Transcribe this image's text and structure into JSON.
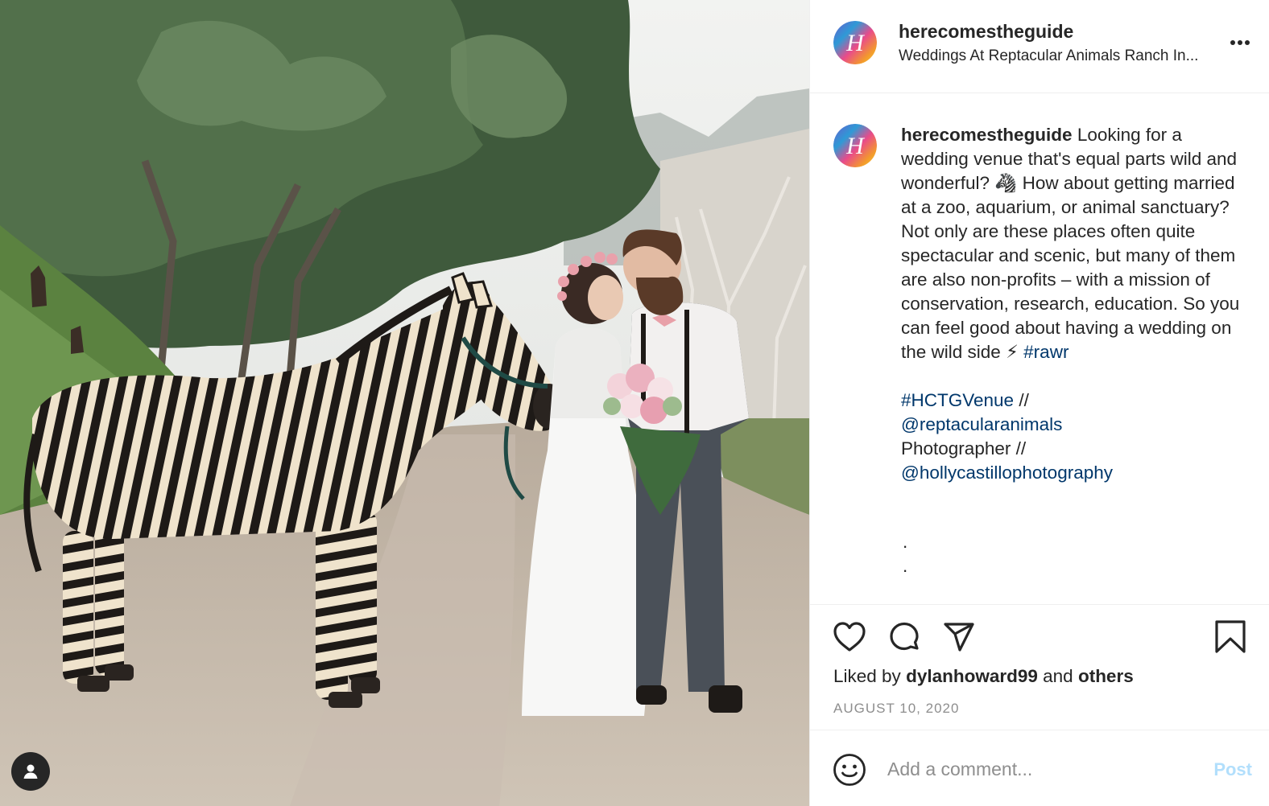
{
  "post": {
    "username": "herecomestheguide",
    "location": "Weddings At Reptacular Animals Ranch In...",
    "avatar_letter": "H"
  },
  "caption": {
    "username": "herecomestheguide",
    "text_1": "Looking for a wedding venue that's equal parts wild and wonderful?",
    "emoji_zebra": "🦓",
    "text_2": "How about getting married at a zoo, aquarium, or animal sanctuary? Not only are these places often quite spectacular and scenic, but many of them are also non-profits – with a mission of conservation, research, education. So you can feel good about having a wedding on the wild side",
    "emoji_bolt": "⚡",
    "hashtag_rawr": "#rawr",
    "hashtag_venue": "#HCTGVenue",
    "sep_1": " //",
    "mention_venue": "@reptacularanimals",
    "photographer_label": "Photographer //",
    "mention_photographer": "@hollycastillophotography",
    "dot_1": ".",
    "dot_2": "."
  },
  "actions": {
    "liked_by_prefix": "Liked by",
    "liked_by_user": "dylanhoward99",
    "liked_by_and": "and",
    "liked_by_others": "others",
    "date": "AUGUST 10, 2020"
  },
  "comment": {
    "placeholder": "Add a comment...",
    "post_label": "Post"
  },
  "icons": [
    "user-tag-icon",
    "more-options-icon",
    "heart-icon",
    "comment-icon",
    "share-icon",
    "bookmark-icon",
    "emoji-icon"
  ],
  "colors": {
    "link": "#00376b",
    "post_button_disabled": "#b2dffc",
    "muted_text": "#8e8e8e",
    "divider": "#efefef"
  }
}
